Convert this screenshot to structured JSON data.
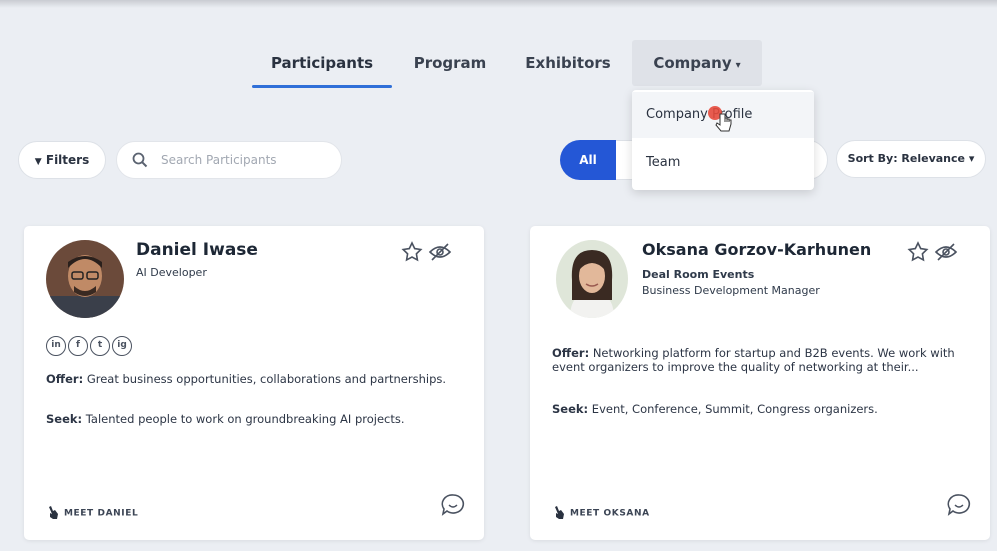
{
  "nav": {
    "participants": "Participants",
    "program": "Program",
    "exhibitors": "Exhibitors",
    "company": "Company",
    "company_caret": "▾",
    "dropdown": [
      "Company Profile",
      "Team"
    ]
  },
  "toolbar": {
    "filters_label": "Filters",
    "filter_glyph": "▼",
    "search_placeholder": "Search Participants",
    "all_label": "All",
    "sort_label": "Sort By: Relevance ▾"
  },
  "cards": [
    {
      "name": "Daniel Iwase",
      "role": "AI Developer",
      "socials": [
        "in",
        "f",
        "t",
        "ig"
      ],
      "offer_label": "Offer:",
      "offer": "Great business opportunities, collaborations and partnerships.",
      "seek_label": "Seek:",
      "seek": "Talented people to work on groundbreaking AI projects.",
      "meet": "MEET DANIEL"
    },
    {
      "name": "Oksana Gorzov-Karhunen",
      "company": "Deal Room Events",
      "role": "Business Development Manager",
      "offer_label": "Offer:",
      "offer": "Networking platform for startup and B2B events. We work with event organizers to improve the quality of networking at their...",
      "seek_label": "Seek:",
      "seek": "Event, Conference, Summit, Congress organizers.",
      "meet": "MEET OKSANA"
    }
  ],
  "colors": {
    "accent": "#2457d6",
    "underline": "#2f6fd8",
    "click": "#e64a3c",
    "background": "#ebeef3"
  }
}
